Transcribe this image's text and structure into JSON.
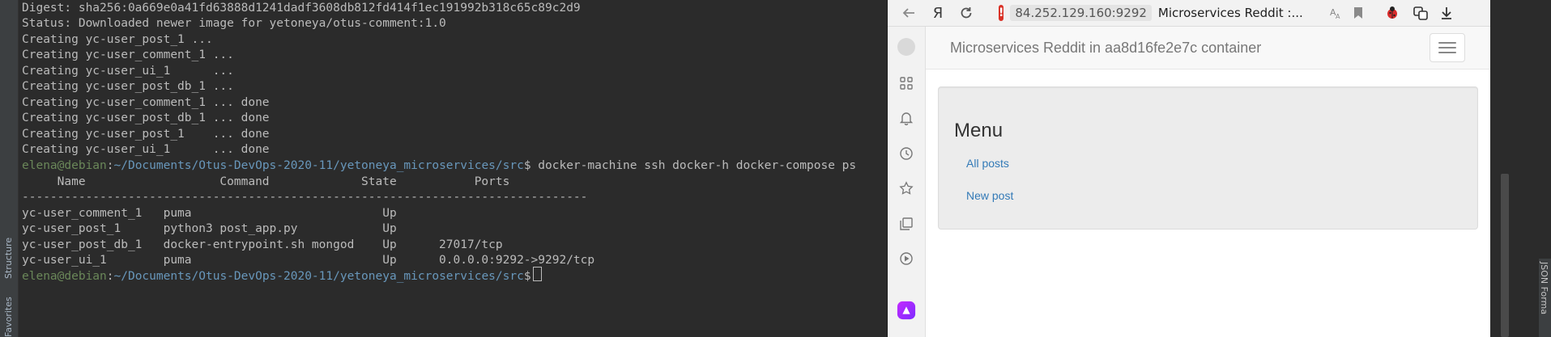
{
  "ide": {
    "side_tabs": {
      "structure": "Structure",
      "favorites": "Favorites"
    },
    "right_tab": "JSON Forma"
  },
  "terminal": {
    "lines": [
      "Digest: sha256:0a669e0a41fd63888d1241dadf3608db812fd414f1ec191992b318c65c89c2d9",
      "Status: Downloaded newer image for yetoneya/otus-comment:1.0",
      "Creating yc-user_post_1 ...",
      "Creating yc-user_comment_1 ...",
      "Creating yc-user_ui_1      ...",
      "Creating yc-user_post_db_1 ...",
      "Creating yc-user_comment_1 ... done",
      "Creating yc-user_post_db_1 ... done",
      "Creating yc-user_post_1    ... done",
      "Creating yc-user_ui_1      ... done"
    ],
    "prompt_user": "elena@debian",
    "prompt_path": "~/Documents/Otus-DevOps-2020-11/yetoneya_microservices/src",
    "prompt_cmd": "$ docker-machine ssh docker-h docker-compose ps",
    "table_header": "     Name                   Command             State           Ports",
    "table_divider": "--------------------------------------------------------------------------------",
    "rows": [
      "yc-user_comment_1   puma                           Up",
      "yc-user_post_1      python3 post_app.py            Up",
      "yc-user_post_db_1   docker-entrypoint.sh mongod    Up      27017/tcp",
      "yc-user_ui_1        puma                           Up      0.0.0.0:9292->9292/tcp"
    ],
    "last_prompt_user": "elena@debian",
    "last_prompt_path": "~/Documents/Otus-DevOps-2020-11/yetoneya_microservices/src",
    "last_prompt_cmd": "$"
  },
  "browser": {
    "yandex_glyph": "Я",
    "host": "84.252.129.160:9292",
    "tab_title": "Microservices Reddit :...",
    "navbar_brand": "Microservices Reddit in aa8d16fe2e7c container",
    "menu_title": "Menu",
    "menu_links": [
      "All posts",
      "New post"
    ]
  },
  "colors": {
    "terminal_bg": "#2b2b2b",
    "terminal_text": "#bbbbbb",
    "prompt_user": "#6a8759",
    "prompt_path": "#6897bb",
    "link": "#337ab7",
    "warning": "#d93025"
  },
  "icons": {
    "sidebar": [
      "avatar-icon",
      "apps-grid-icon",
      "bell-icon",
      "clock-icon",
      "star-icon",
      "collections-icon",
      "play-icon",
      "alice-icon"
    ],
    "toolbar": [
      "back-arrow-icon",
      "reload-icon",
      "warning-icon",
      "reader-mode-icon",
      "bookmark-icon",
      "ladybug-icon",
      "translate-icon",
      "download-icon"
    ]
  }
}
